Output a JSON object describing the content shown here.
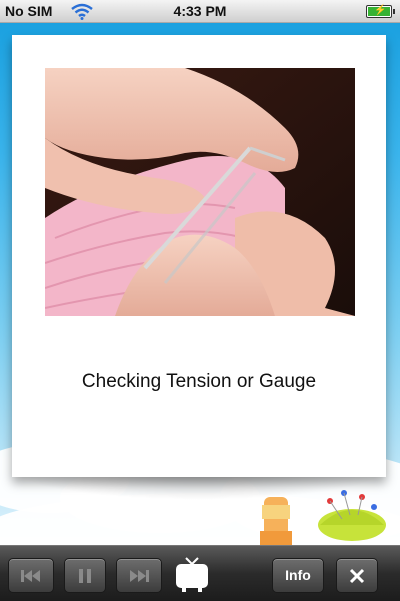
{
  "status_bar": {
    "carrier": "No SIM",
    "time": "4:33 PM",
    "icons": [
      "wifi-icon",
      "battery-charging-icon"
    ]
  },
  "card": {
    "image_description": "Hands holding knitting needles with pink knitted fabric",
    "caption": "Checking Tension or Gauge"
  },
  "toolbar": {
    "buttons": [
      {
        "name": "previous",
        "icon": "skip-back-icon",
        "enabled": false
      },
      {
        "name": "pause",
        "icon": "pause-icon",
        "enabled": false
      },
      {
        "name": "next",
        "icon": "skip-forward-icon",
        "enabled": false
      },
      {
        "name": "tv",
        "icon": "tv-icon",
        "enabled": true
      },
      {
        "name": "info",
        "label": "Info",
        "enabled": true
      },
      {
        "name": "close",
        "icon": "close-icon",
        "enabled": true
      }
    ]
  },
  "colors": {
    "sky_top": "#1ba1e0",
    "toolbar": "#2b2b2b",
    "yarn_pink": "#f1a7c0"
  }
}
